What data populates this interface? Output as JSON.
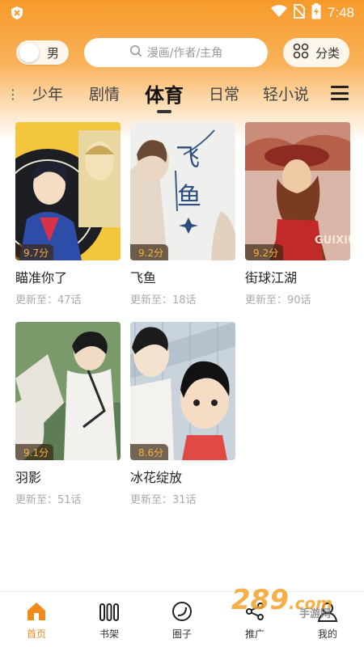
{
  "status_bar": {
    "time": "7:48",
    "icons": [
      "app-badge-icon",
      "wifi-icon",
      "no-sim-icon",
      "battery-charging-icon"
    ]
  },
  "gender_toggle": {
    "label": "男"
  },
  "search": {
    "placeholder": "漫画/作者/主角",
    "icon": "search-icon"
  },
  "category_button": {
    "label": "分类",
    "icon": "grid-icon"
  },
  "tabs": [
    {
      "label": "少年"
    },
    {
      "label": "剧情"
    },
    {
      "label": "体育",
      "active": true
    },
    {
      "label": "日常"
    },
    {
      "label": "轻小说"
    }
  ],
  "comics": [
    {
      "title": "瞄准你了",
      "rating": "9.7分",
      "update": "更新至：47话"
    },
    {
      "title": "飞鱼",
      "rating": "9.2分",
      "update": "更新至：18话",
      "cover_text": "飞\n鱼"
    },
    {
      "title": "街球江湖",
      "rating": "9.2分",
      "update": "更新至：90话"
    },
    {
      "title": "羽影",
      "rating": "9.1分",
      "update": "更新至：51话"
    },
    {
      "title": "冰花绽放",
      "rating": "8.6分",
      "update": "更新至：31话"
    }
  ],
  "bottom_nav": [
    {
      "label": "首页",
      "icon": "home-icon",
      "active": true
    },
    {
      "label": "书架",
      "icon": "bookshelf-icon"
    },
    {
      "label": "圈子",
      "icon": "circle-icon"
    },
    {
      "label": "推广",
      "icon": "share-icon"
    },
    {
      "label": "我的",
      "icon": "user-icon"
    }
  ],
  "watermark": {
    "text": "289",
    "sub": "手游网",
    "domain": ".com"
  },
  "colors": {
    "accent": "#f08a1c",
    "rating": "#f5b041",
    "header_top": "#f79a2a"
  }
}
